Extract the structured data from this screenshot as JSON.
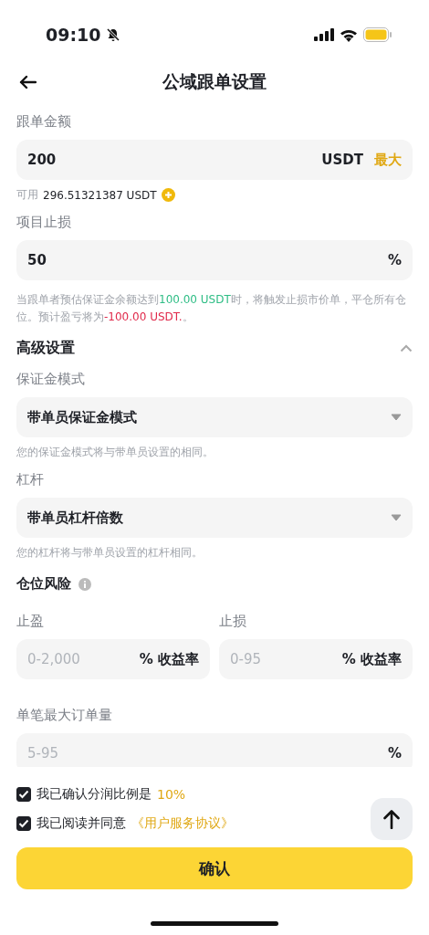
{
  "status_bar": {
    "time": "09:10"
  },
  "header": {
    "title": "公域跟单设置"
  },
  "amount": {
    "label": "跟单金额",
    "value": "200",
    "unit": "USDT",
    "max_label": "最大",
    "available_label": "可用",
    "available_value": "296.51321387 USDT"
  },
  "stop_loss": {
    "label": "项目止损",
    "value": "50",
    "unit": "%",
    "note": [
      {
        "text": "当跟单者预估保证金余额达到",
        "kind": "plain"
      },
      {
        "text": "100.00 USDT",
        "kind": "gain"
      },
      {
        "text": "时，将触发止损市价单，平仓所有仓位。预计盈亏将为",
        "kind": "plain"
      },
      {
        "text": "-100.00 USDT.",
        "kind": "loss"
      },
      {
        "text": "。",
        "kind": "plain"
      }
    ]
  },
  "advanced": {
    "title": "高级设置",
    "expanded": true
  },
  "margin_mode": {
    "label": "保证金模式",
    "value": "带单员保证金模式",
    "hint": "您的保证金模式将与带单员设置的相同。"
  },
  "leverage": {
    "label": "杠杆",
    "value": "带单员杠杆倍数",
    "hint": "您的杠杆将与带单员设置的杠杆相同。"
  },
  "position_risk": {
    "title": "仓位风险",
    "fields": [
      {
        "label": "止盈",
        "placeholder": "0-2,000",
        "unit": "% 收益率"
      },
      {
        "label": "止损",
        "placeholder": "0-95",
        "unit": "% 收益率"
      }
    ]
  },
  "max_order": {
    "label": "单笔最大订单量",
    "placeholder": "5-95",
    "unit": "%"
  },
  "agreements": [
    {
      "text": "我已确认分润比例是",
      "highlight": "10%",
      "checked": true
    },
    {
      "text": "我已阅读并同意",
      "highlight": "《用户服务协议》",
      "checked": true
    }
  ],
  "confirm_button": "确认"
}
